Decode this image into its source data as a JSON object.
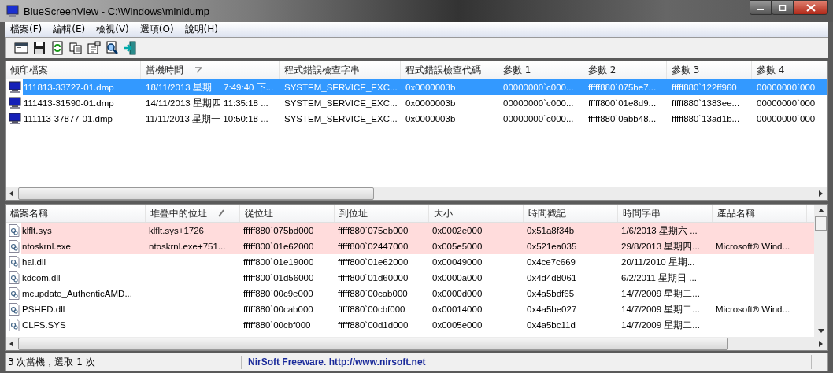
{
  "window": {
    "title": "BlueScreenView  -  C:\\Windows\\minidump"
  },
  "menu": [
    "檔案(F)",
    "編輯(E)",
    "檢視(V)",
    "選項(O)",
    "說明(H)"
  ],
  "toolbar": [
    {
      "kind": "window"
    },
    {
      "kind": "save"
    },
    {
      "kind": "refresh"
    },
    {
      "kind": "copy"
    },
    {
      "kind": "properties"
    },
    {
      "kind": "find"
    },
    {
      "kind": "exit"
    }
  ],
  "crash_list": {
    "columns": [
      {
        "label": "傾印檔案",
        "sorted": false
      },
      {
        "label": "當機時間",
        "sorted": true
      },
      {
        "label": "程式錯誤檢查字串",
        "sorted": false
      },
      {
        "label": "程式錯誤檢查代碼",
        "sorted": false
      },
      {
        "label": "參數 1",
        "sorted": false
      },
      {
        "label": "參數 2",
        "sorted": false
      },
      {
        "label": "參數 3",
        "sorted": false
      },
      {
        "label": "參數 4",
        "sorted": false
      }
    ],
    "rows": [
      {
        "selected": true,
        "cells": [
          "111813-33727-01.dmp",
          "18/11/2013 星期一 7:49:40 下...",
          "SYSTEM_SERVICE_EXC...",
          "0x0000003b",
          "00000000`c000...",
          "fffff880`075be7...",
          "fffff880`122ff960",
          "00000000`000"
        ]
      },
      {
        "selected": false,
        "cells": [
          "111413-31590-01.dmp",
          "14/11/2013 星期四 11:35:18 ...",
          "SYSTEM_SERVICE_EXC...",
          "0x0000003b",
          "00000000`c000...",
          "fffff800`01e8d9...",
          "fffff880`1383ee...",
          "00000000`000"
        ]
      },
      {
        "selected": false,
        "cells": [
          "111113-37877-01.dmp",
          "11/11/2013 星期一 10:50:18 ...",
          "SYSTEM_SERVICE_EXC...",
          "0x0000003b",
          "00000000`c000...",
          "fffff880`0abb48...",
          "fffff880`13ad1b...",
          "00000000`000"
        ]
      }
    ]
  },
  "driver_list": {
    "columns": [
      {
        "label": "檔案名稱",
        "sorted": false
      },
      {
        "label": "堆疊中的位址",
        "sorted": true
      },
      {
        "label": "從位址",
        "sorted": false
      },
      {
        "label": "到位址",
        "sorted": false
      },
      {
        "label": "大小",
        "sorted": false
      },
      {
        "label": "時間戳記",
        "sorted": false
      },
      {
        "label": "時間字串",
        "sorted": false
      },
      {
        "label": "產品名稱",
        "sorted": false
      }
    ],
    "rows": [
      {
        "highlighted": true,
        "cells": [
          "klflt.sys",
          "klflt.sys+1726",
          "fffff880`075bd000",
          "fffff880`075eb000",
          "0x0002e000",
          "0x51a8f34b",
          "1/6/2013 星期六 ...",
          ""
        ]
      },
      {
        "highlighted": true,
        "cells": [
          "ntoskrnl.exe",
          "ntoskrnl.exe+751...",
          "fffff800`01e62000",
          "fffff800`02447000",
          "0x005e5000",
          "0x521ea035",
          "29/8/2013 星期四...",
          "Microsoft® Wind..."
        ]
      },
      {
        "highlighted": false,
        "cells": [
          "hal.dll",
          "",
          "fffff800`01e19000",
          "fffff800`01e62000",
          "0x00049000",
          "0x4ce7c669",
          "20/11/2010 星期...",
          ""
        ]
      },
      {
        "highlighted": false,
        "cells": [
          "kdcom.dll",
          "",
          "fffff800`01d56000",
          "fffff800`01d60000",
          "0x0000a000",
          "0x4d4d8061",
          "6/2/2011 星期日 ...",
          ""
        ]
      },
      {
        "highlighted": false,
        "cells": [
          "mcupdate_AuthenticAMD...",
          "",
          "fffff880`00c9e000",
          "fffff880`00cab000",
          "0x0000d000",
          "0x4a5bdf65",
          "14/7/2009 星期二...",
          ""
        ]
      },
      {
        "highlighted": false,
        "cells": [
          "PSHED.dll",
          "",
          "fffff880`00cab000",
          "fffff880`00cbf000",
          "0x00014000",
          "0x4a5be027",
          "14/7/2009 星期二...",
          "Microsoft® Wind..."
        ]
      },
      {
        "highlighted": false,
        "cells": [
          "CLFS.SYS",
          "",
          "fffff880`00cbf000",
          "fffff880`00d1d000",
          "0x0005e000",
          "0x4a5bc11d",
          "14/7/2009 星期二...",
          ""
        ]
      }
    ]
  },
  "status_bar": {
    "summary": "3 次當機，選取 1 次",
    "link": "NirSoft Freeware.  http://www.nirsoft.net"
  }
}
